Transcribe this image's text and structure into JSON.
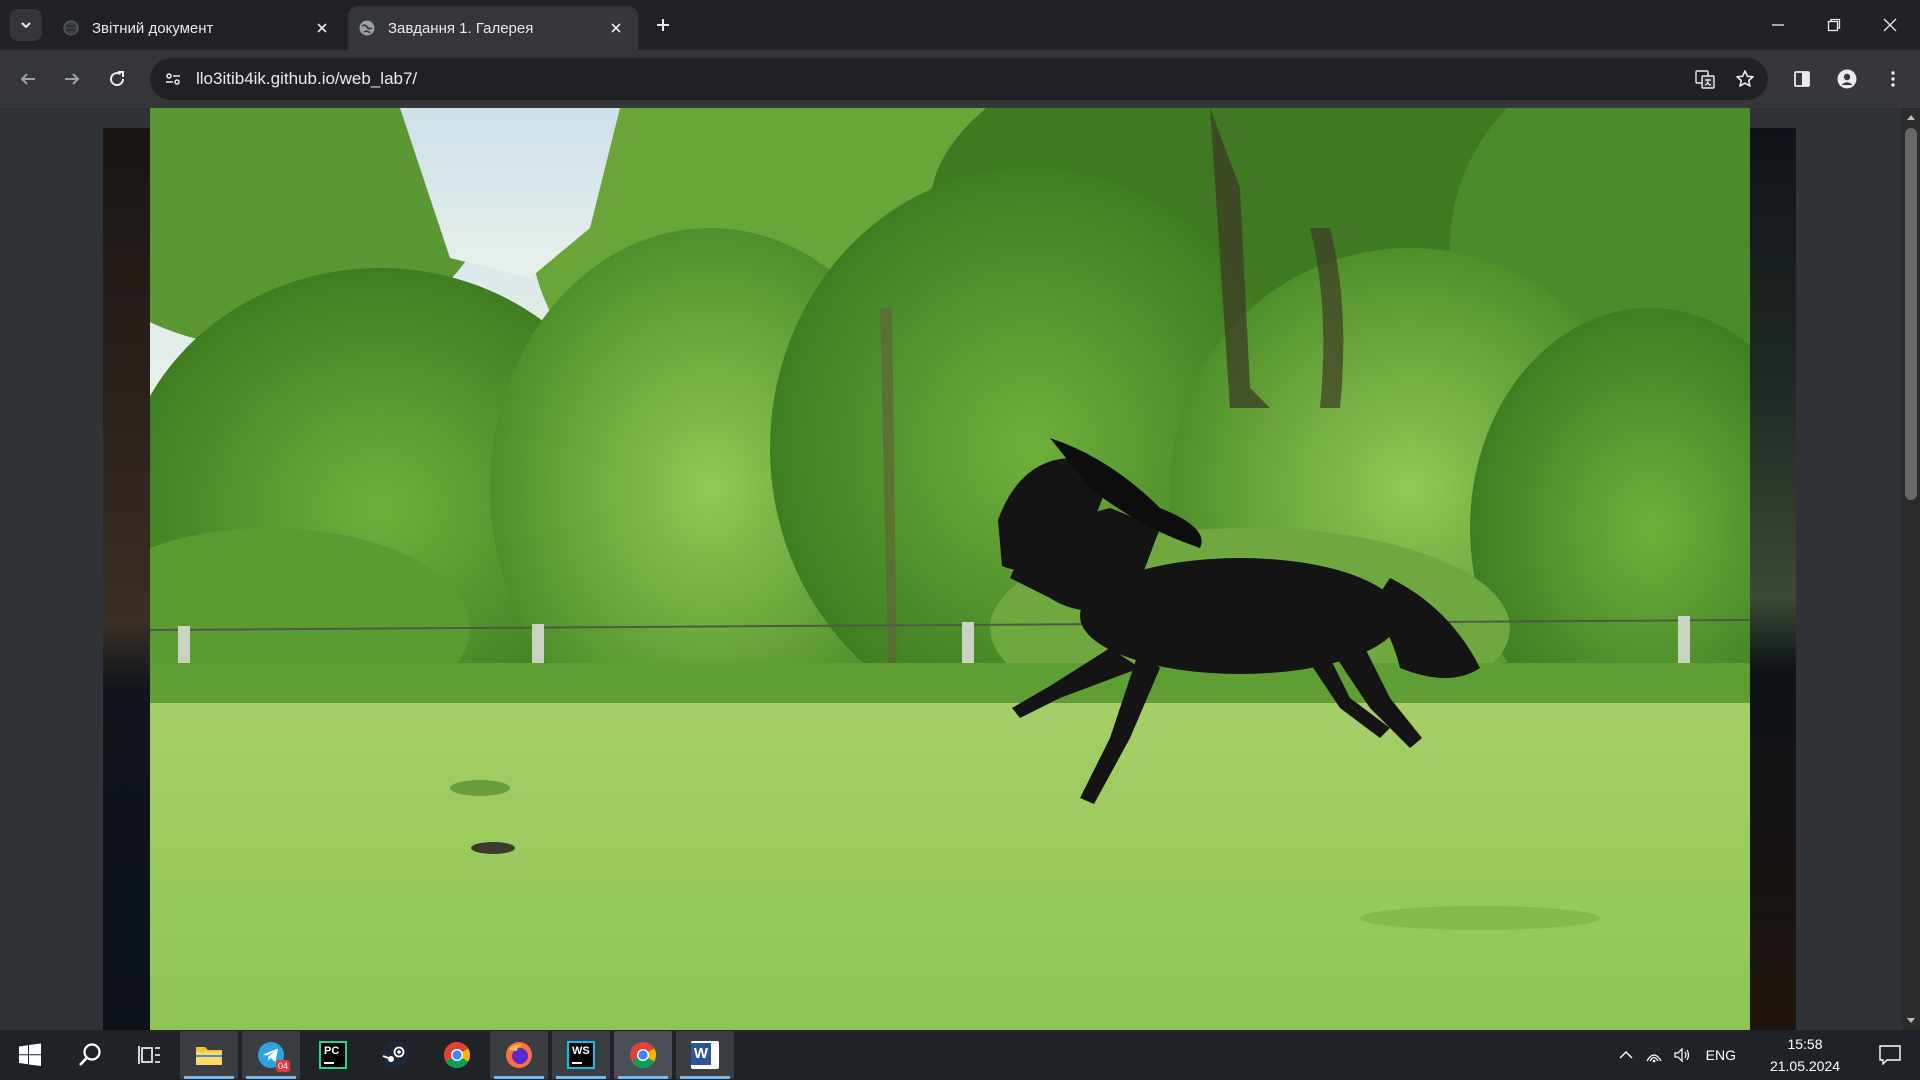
{
  "browser": {
    "tabs": [
      {
        "title": "Звітний документ",
        "active": false
      },
      {
        "title": "Завдання 1. Галерея",
        "active": true
      }
    ],
    "url": "llo3itib4ik.github.io/web_lab7/"
  },
  "taskbar": {
    "apps": [
      "file-explorer",
      "telegram",
      "pycharm",
      "steam",
      "chrome",
      "firefox",
      "webstorm",
      "chrome",
      "word"
    ],
    "telegram_badge": "04",
    "pycharm_label": "PC",
    "webstorm_label": "WS",
    "word_label": "W"
  },
  "tray": {
    "language": "ENG",
    "time": "15:58",
    "date": "21.05.2024"
  },
  "colors": {
    "accent": "#76b9ed",
    "chrome_dark": "#202124",
    "chrome_toolbar": "#35363a"
  }
}
